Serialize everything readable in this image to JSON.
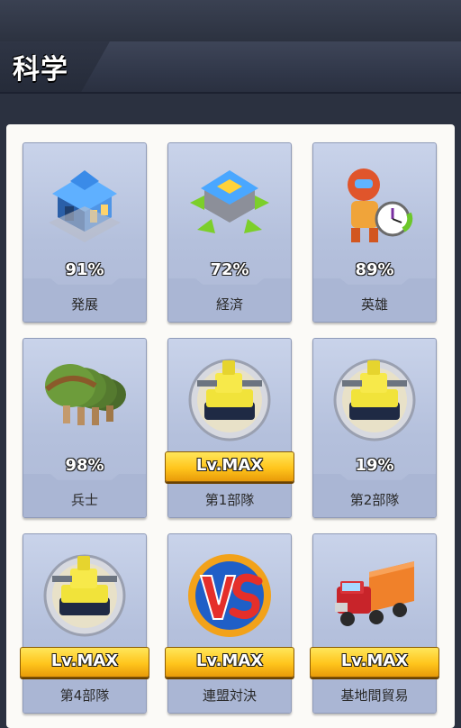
{
  "header": {
    "title": "科学"
  },
  "cards": [
    {
      "name": "発展",
      "percent": "91%",
      "icon": "building-icon"
    },
    {
      "name": "経済",
      "percent": "72%",
      "icon": "economy-icon"
    },
    {
      "name": "英雄",
      "percent": "89%",
      "icon": "hero-icon"
    },
    {
      "name": "兵士",
      "percent": "98%",
      "icon": "helmet-icon"
    },
    {
      "name": "第1部隊",
      "badge": "Lv.MAX",
      "icon": "tank-icon"
    },
    {
      "name": "第2部隊",
      "percent": "19%",
      "icon": "tank-icon"
    },
    {
      "name": "第4部隊",
      "badge": "Lv.MAX",
      "icon": "tank-icon"
    },
    {
      "name": "連盟対決",
      "badge": "Lv.MAX",
      "icon": "vs-icon"
    },
    {
      "name": "基地間貿易",
      "badge": "Lv.MAX",
      "icon": "truck-icon"
    }
  ],
  "colors": {
    "card_bg": "#c0cbe4",
    "badge_gold": "#ffc51c",
    "panel_bg": "#fbfaf7"
  }
}
